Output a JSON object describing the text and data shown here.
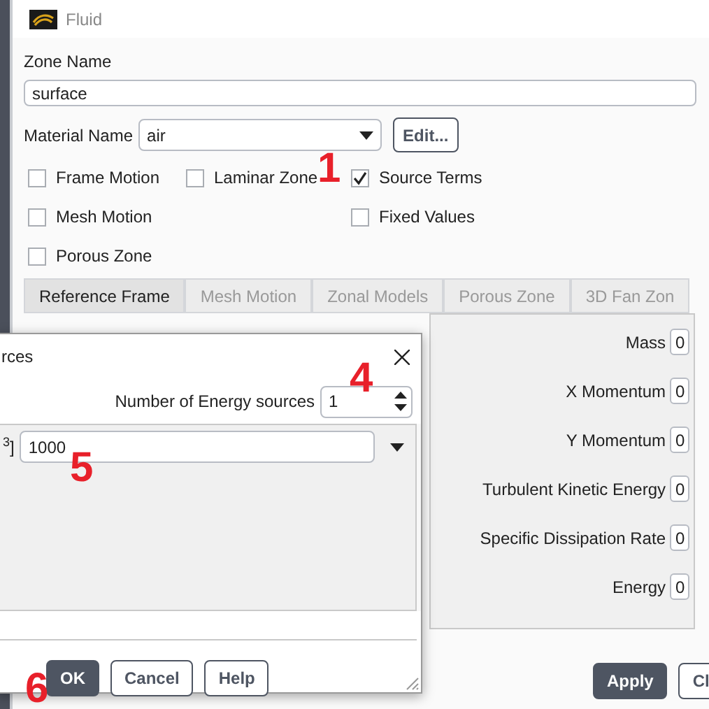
{
  "window": {
    "title": "Fluid"
  },
  "zone_name": {
    "label": "Zone Name",
    "value": "surface"
  },
  "material": {
    "label": "Material Name",
    "value": "air",
    "edit_button": "Edit..."
  },
  "options": [
    {
      "label": "Frame Motion",
      "checked": false
    },
    {
      "label": "Laminar Zone",
      "checked": false
    },
    {
      "label": "Source Terms",
      "checked": true
    },
    {
      "label": "Mesh Motion",
      "checked": false
    },
    {
      "label": "Fixed Values",
      "checked": false
    },
    {
      "label": "Porous Zone",
      "checked": false
    }
  ],
  "tabs": [
    {
      "label": "Reference Frame",
      "selected": true
    },
    {
      "label": "Mesh Motion",
      "selected": false
    },
    {
      "label": "Zonal Models",
      "selected": false
    },
    {
      "label": "Porous Zone",
      "selected": false
    },
    {
      "label": "3D Fan Zon",
      "selected": false
    }
  ],
  "sources": [
    {
      "label": "Mass",
      "value": "0"
    },
    {
      "label": "X Momentum",
      "value": "0"
    },
    {
      "label": "Y Momentum",
      "value": "0"
    },
    {
      "label": "Turbulent Kinetic Energy",
      "value": "0"
    },
    {
      "label": "Specific Dissipation Rate",
      "value": "0"
    },
    {
      "label": "Energy",
      "value": "0"
    }
  ],
  "buttons": [
    "Apply",
    "Cl"
  ],
  "dialog": {
    "title": "rces",
    "count_label": "Number of Energy sources",
    "count": "1",
    "unit_label": "$^{3}$]",
    "value": "1000",
    "buttons": [
      "OK",
      "Cancel",
      "Help"
    ]
  },
  "annotations": [
    "1",
    "4",
    "5",
    "6"
  ]
}
